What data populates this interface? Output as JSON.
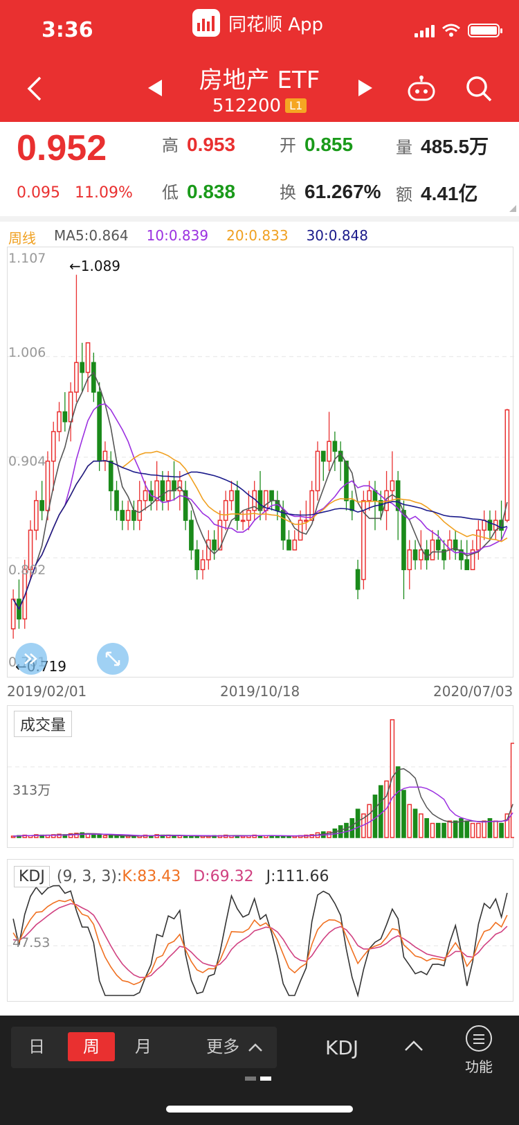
{
  "status_bar": {
    "time": "3:36",
    "app_name": "同花顺 App"
  },
  "header": {
    "title": "房地产 ETF",
    "code": "512200",
    "level_badge": "L1"
  },
  "quote": {
    "price": "0.952",
    "change": "0.095",
    "change_pct": "11.09%",
    "high_label": "高",
    "high": "0.953",
    "low_label": "低",
    "low": "0.838",
    "open_label": "开",
    "open": "0.855",
    "turnover_label": "换",
    "turnover": "61.267%",
    "volume_label": "量",
    "volume": "485.5万",
    "amount_label": "额",
    "amount": "4.41亿"
  },
  "ma_legend": {
    "period": "周线",
    "ma5": "MA5:0.864",
    "ma10": "10:0.839",
    "ma20": "20:0.833",
    "ma30": "30:0.848"
  },
  "colors": {
    "up": "#e93030",
    "down": "#1a8a1a",
    "ma5": "#555555",
    "ma10": "#9b30e0",
    "ma20": "#f0a020",
    "ma30": "#1a1a8a",
    "k": "#f07020",
    "d": "#d04080",
    "j": "#333333"
  },
  "price_chart": {
    "y_ticks": [
      "1.107",
      "1.006",
      "0.904",
      "0.802",
      "0.701"
    ],
    "max_annotation": "←1.089",
    "min_annotation": "←0.719",
    "x_labels": [
      "2019/02/01",
      "2019/10/18",
      "2020/07/03"
    ]
  },
  "volume_panel": {
    "label": "成交量",
    "tick": "313万"
  },
  "kdj_panel": {
    "label": "KDJ",
    "params": "(9, 3, 3):",
    "k": "K:83.43",
    "d": "D:69.32",
    "j": "J:111.66",
    "tick": "47.53"
  },
  "bottom_bar": {
    "tabs": [
      "日",
      "周",
      "月",
      "更多"
    ],
    "active_tab": "周",
    "indicator": "KDJ",
    "func_label": "功能"
  },
  "chart_data": {
    "type": "candlestick",
    "title": "",
    "ylim": [
      0.701,
      1.107
    ],
    "candles": [
      [
        0.73,
        0.76,
        0.77,
        0.72
      ],
      [
        0.76,
        0.74,
        0.78,
        0.73
      ],
      [
        0.74,
        0.79,
        0.8,
        0.73
      ],
      [
        0.79,
        0.83,
        0.84,
        0.78
      ],
      [
        0.83,
        0.86,
        0.87,
        0.82
      ],
      [
        0.86,
        0.85,
        0.88,
        0.84
      ],
      [
        0.85,
        0.9,
        0.91,
        0.84
      ],
      [
        0.9,
        0.93,
        0.94,
        0.87
      ],
      [
        0.93,
        0.95,
        0.96,
        0.92
      ],
      [
        0.95,
        0.94,
        0.97,
        0.93
      ],
      [
        0.94,
        0.97,
        0.98,
        0.92
      ],
      [
        0.97,
        1.0,
        1.089,
        0.96
      ],
      [
        1.0,
        0.99,
        1.02,
        0.97
      ],
      [
        0.99,
        1.02,
        1.02,
        0.97
      ],
      [
        1.0,
        0.97,
        1.01,
        0.96
      ],
      [
        0.97,
        0.9,
        0.98,
        0.89
      ],
      [
        0.9,
        0.91,
        0.92,
        0.89
      ],
      [
        0.9,
        0.87,
        0.91,
        0.85
      ],
      [
        0.87,
        0.85,
        0.88,
        0.84
      ],
      [
        0.85,
        0.84,
        0.86,
        0.83
      ],
      [
        0.84,
        0.85,
        0.86,
        0.83
      ],
      [
        0.85,
        0.84,
        0.86,
        0.83
      ],
      [
        0.84,
        0.86,
        0.88,
        0.83
      ],
      [
        0.86,
        0.87,
        0.88,
        0.85
      ],
      [
        0.87,
        0.86,
        0.88,
        0.85
      ],
      [
        0.86,
        0.88,
        0.9,
        0.85
      ],
      [
        0.88,
        0.86,
        0.89,
        0.85
      ],
      [
        0.86,
        0.88,
        0.89,
        0.85
      ],
      [
        0.88,
        0.87,
        0.9,
        0.86
      ],
      [
        0.87,
        0.88,
        0.89,
        0.85
      ],
      [
        0.87,
        0.84,
        0.88,
        0.83
      ],
      [
        0.84,
        0.81,
        0.85,
        0.8
      ],
      [
        0.81,
        0.79,
        0.82,
        0.78
      ],
      [
        0.79,
        0.8,
        0.81,
        0.78
      ],
      [
        0.8,
        0.82,
        0.83,
        0.79
      ],
      [
        0.82,
        0.81,
        0.83,
        0.8
      ],
      [
        0.81,
        0.84,
        0.85,
        0.81
      ],
      [
        0.84,
        0.86,
        0.87,
        0.83
      ],
      [
        0.86,
        0.87,
        0.88,
        0.85
      ],
      [
        0.87,
        0.84,
        0.88,
        0.83
      ],
      [
        0.84,
        0.84,
        0.85,
        0.83
      ],
      [
        0.84,
        0.85,
        0.87,
        0.83
      ],
      [
        0.85,
        0.87,
        0.88,
        0.84
      ],
      [
        0.87,
        0.85,
        0.89,
        0.84
      ],
      [
        0.85,
        0.87,
        0.87,
        0.84
      ],
      [
        0.87,
        0.86,
        0.87,
        0.85
      ],
      [
        0.86,
        0.85,
        0.87,
        0.84
      ],
      [
        0.85,
        0.82,
        0.86,
        0.81
      ],
      [
        0.82,
        0.81,
        0.83,
        0.81
      ],
      [
        0.81,
        0.82,
        0.83,
        0.81
      ],
      [
        0.82,
        0.84,
        0.85,
        0.82
      ],
      [
        0.84,
        0.84,
        0.86,
        0.83
      ],
      [
        0.84,
        0.87,
        0.88,
        0.84
      ],
      [
        0.87,
        0.91,
        0.92,
        0.86
      ],
      [
        0.91,
        0.9,
        0.91,
        0.88
      ],
      [
        0.9,
        0.92,
        0.95,
        0.89
      ],
      [
        0.92,
        0.91,
        0.93,
        0.89
      ],
      [
        0.91,
        0.9,
        0.92,
        0.88
      ],
      [
        0.9,
        0.86,
        0.9,
        0.85
      ],
      [
        0.86,
        0.85,
        0.87,
        0.84
      ],
      [
        0.79,
        0.77,
        0.8,
        0.76
      ],
      [
        0.78,
        0.86,
        0.87,
        0.77
      ],
      [
        0.86,
        0.87,
        0.88,
        0.85
      ],
      [
        0.87,
        0.86,
        0.88,
        0.83
      ],
      [
        0.86,
        0.85,
        0.87,
        0.84
      ],
      [
        0.85,
        0.87,
        0.89,
        0.83
      ],
      [
        0.87,
        0.88,
        0.91,
        0.86
      ],
      [
        0.88,
        0.85,
        0.89,
        0.82
      ],
      [
        0.85,
        0.79,
        0.86,
        0.76
      ],
      [
        0.79,
        0.81,
        0.82,
        0.77
      ],
      [
        0.81,
        0.8,
        0.82,
        0.79
      ],
      [
        0.8,
        0.81,
        0.83,
        0.79
      ],
      [
        0.81,
        0.8,
        0.82,
        0.79
      ],
      [
        0.8,
        0.82,
        0.83,
        0.8
      ],
      [
        0.82,
        0.81,
        0.83,
        0.8
      ],
      [
        0.81,
        0.8,
        0.82,
        0.79
      ],
      [
        0.81,
        0.82,
        0.83,
        0.8
      ],
      [
        0.82,
        0.81,
        0.83,
        0.8
      ],
      [
        0.81,
        0.8,
        0.82,
        0.79
      ],
      [
        0.8,
        0.79,
        0.82,
        0.79
      ],
      [
        0.79,
        0.81,
        0.82,
        0.79
      ],
      [
        0.81,
        0.83,
        0.84,
        0.8
      ],
      [
        0.83,
        0.84,
        0.85,
        0.82
      ],
      [
        0.84,
        0.83,
        0.85,
        0.82
      ],
      [
        0.83,
        0.84,
        0.85,
        0.82
      ],
      [
        0.84,
        0.83,
        0.86,
        0.82
      ],
      [
        0.84,
        0.952,
        0.953,
        0.838
      ]
    ],
    "volume": [
      3,
      4,
      5,
      4,
      6,
      5,
      5,
      6,
      7,
      6,
      8,
      9,
      10,
      8,
      6,
      5,
      4,
      4,
      3,
      3,
      3,
      3,
      4,
      5,
      4,
      6,
      5,
      5,
      4,
      4,
      3,
      3,
      3,
      3,
      3,
      4,
      4,
      5,
      4,
      4,
      3,
      4,
      5,
      4,
      4,
      4,
      3,
      3,
      3,
      3,
      4,
      5,
      6,
      10,
      12,
      12,
      18,
      25,
      30,
      40,
      60,
      50,
      70,
      90,
      110,
      120,
      250,
      150,
      100,
      70,
      60,
      50,
      40,
      30,
      30,
      30,
      35,
      35,
      40,
      35,
      30,
      30,
      35,
      40,
      35,
      30,
      50,
      200
    ],
    "kdj_tick": 47.53,
    "kdj_range": [
      0,
      110
    ]
  }
}
